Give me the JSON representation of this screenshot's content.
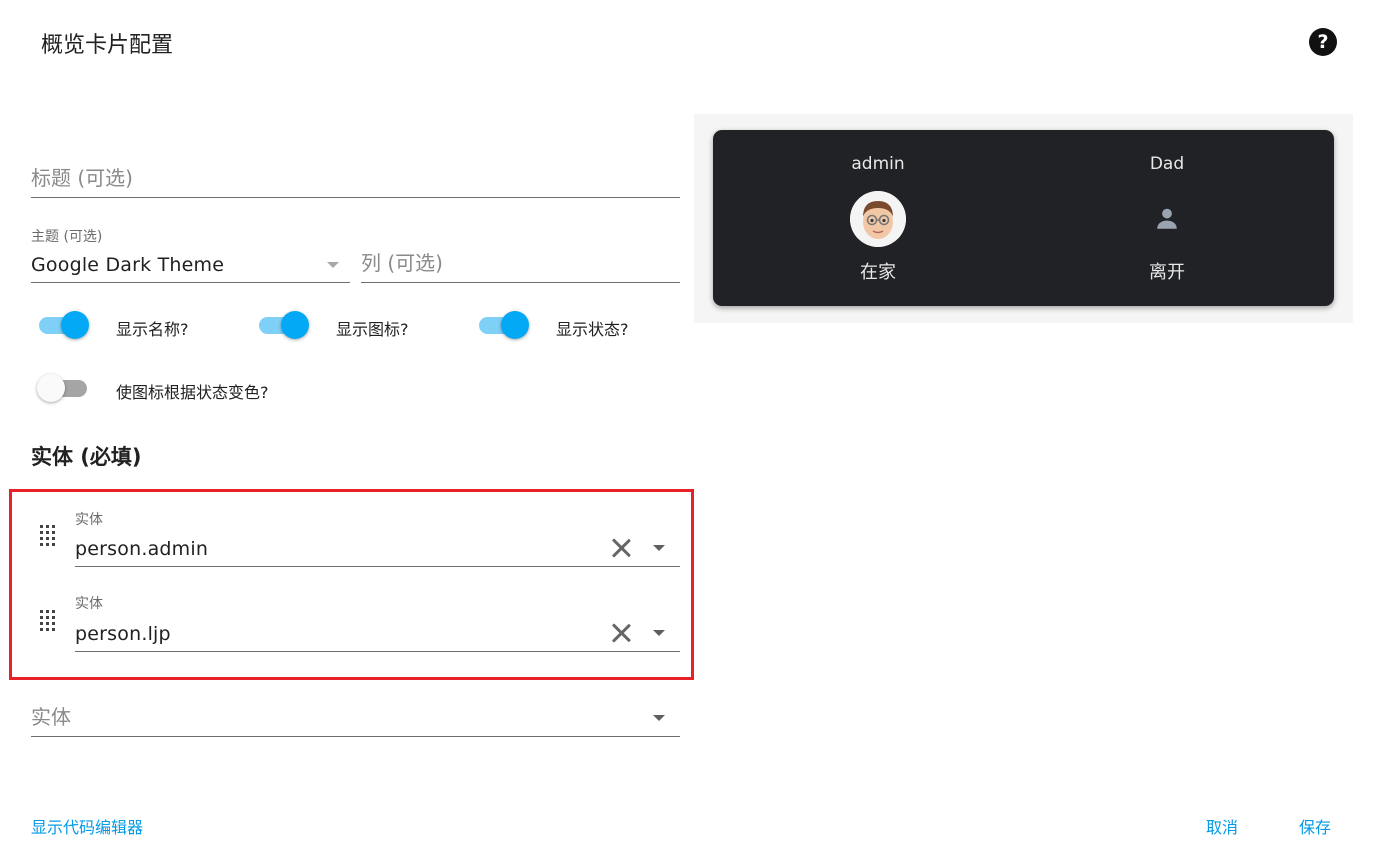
{
  "dialog": {
    "title": "概览卡片配置",
    "help_icon": "question-circle-icon"
  },
  "form": {
    "title_field": {
      "placeholder": "标题 (可选)"
    },
    "theme_field": {
      "label": "主题 (可选)",
      "value": "Google Dark Theme"
    },
    "columns_field": {
      "placeholder": "列 (可选)"
    },
    "toggles": [
      {
        "label": "显示名称?",
        "checked": true
      },
      {
        "label": "显示图标?",
        "checked": true
      },
      {
        "label": "显示状态?",
        "checked": true
      },
      {
        "label": "使图标根据状态变色?",
        "checked": false
      }
    ],
    "entities_title": "实体 (必填)",
    "entities": [
      {
        "label": "实体",
        "value": "person.admin"
      },
      {
        "label": "实体",
        "value": "person.ljp"
      }
    ],
    "new_entity_placeholder": "实体"
  },
  "preview": {
    "entities": [
      {
        "name": "admin",
        "state": "在家",
        "icon": "avatar-memoji"
      },
      {
        "name": "Dad",
        "state": "离开",
        "icon": "account-icon"
      }
    ]
  },
  "footer": {
    "code_editor_label": "显示代码编辑器",
    "cancel_label": "取消",
    "save_label": "保存"
  },
  "colors": {
    "accent": "#03a9f4",
    "link": "#039be5",
    "highlight": "#e8202a",
    "card_bg": "#212226"
  }
}
